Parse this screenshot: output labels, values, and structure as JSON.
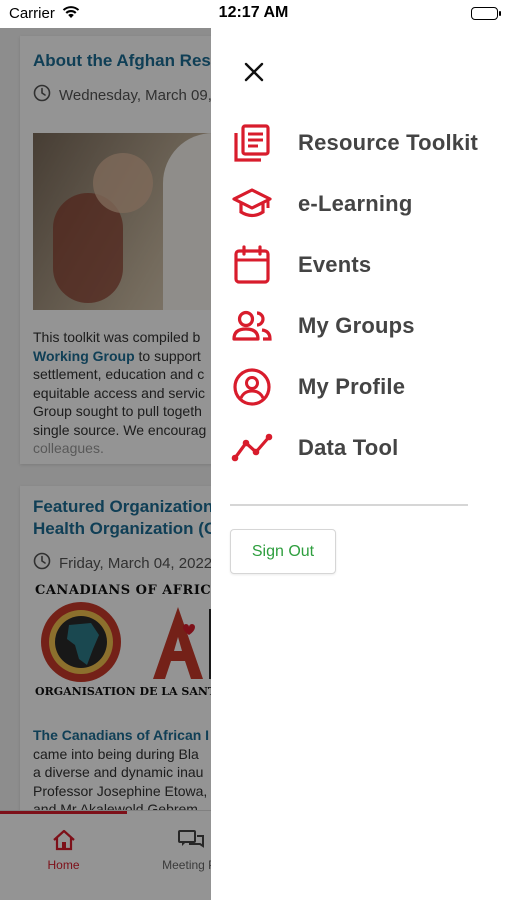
{
  "status_bar": {
    "carrier": "Carrier",
    "time": "12:17 AM"
  },
  "feed": {
    "cards": [
      {
        "title": "About the Afghan Res",
        "date": "Wednesday, March 09,",
        "body_prefix": "This toolkit was compiled b",
        "body_link": "Working Group",
        "body_after_link": " to support",
        "body_lines": [
          "settlement, education and c",
          "equitable access and servic",
          "Group sought to pull togeth",
          "single source. We encourag",
          "colleagues."
        ]
      },
      {
        "title_line1": "Featured Organization",
        "title_line2": "Health Organization (C",
        "date": "Friday, March 04, 2022",
        "logo_top_text": "CANADIANS OF AFRICAN",
        "logo_bottom_text": "ORGANISATION DE LA SANT",
        "body_link": "The Canadians of African I",
        "body_lines": [
          "came into being during Bla",
          "a diverse and dynamic inau",
          "Professor Josephine Etowa,",
          "and Mr Akalewold Gebrem"
        ]
      }
    ]
  },
  "tabbar": {
    "tabs": [
      {
        "label": "Home",
        "icon": "home-icon",
        "active": true
      },
      {
        "label": "Meeting Pl",
        "icon": "chat-icon",
        "active": false
      }
    ]
  },
  "drawer": {
    "menu": [
      {
        "label": "Resource Toolkit",
        "icon": "document-icon"
      },
      {
        "label": "e-Learning",
        "icon": "graduation-cap-icon"
      },
      {
        "label": "Events",
        "icon": "calendar-icon"
      },
      {
        "label": "My Groups",
        "icon": "group-icon"
      },
      {
        "label": "My Profile",
        "icon": "profile-icon"
      },
      {
        "label": "Data Tool",
        "icon": "line-chart-icon"
      }
    ],
    "sign_out": "Sign Out"
  },
  "colors": {
    "accent": "#d81c2c",
    "link": "#1d6d94",
    "signout_text": "#2e9e3e"
  }
}
